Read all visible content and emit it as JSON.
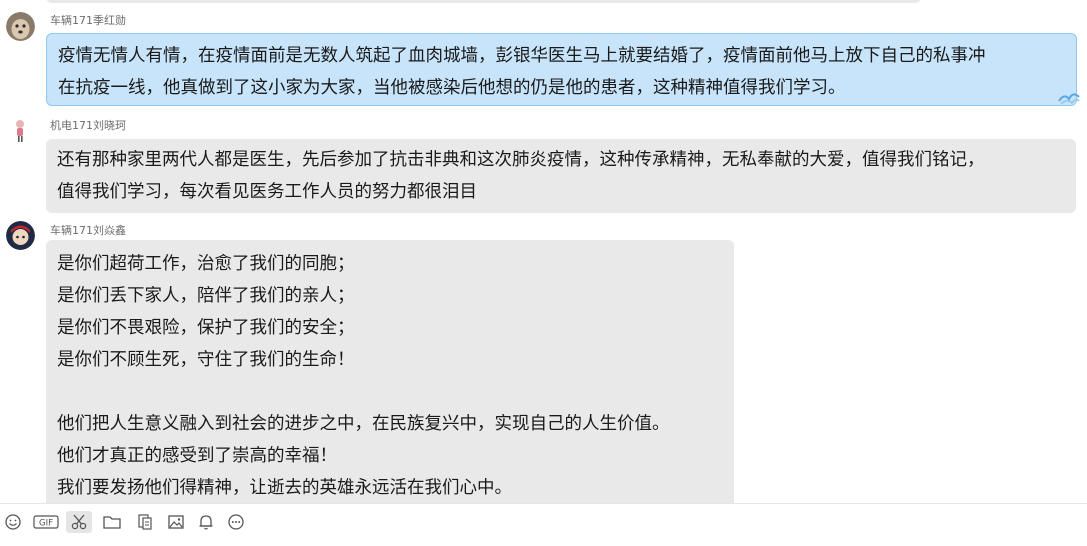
{
  "messages": [
    {
      "sender": "车辆171季红勋",
      "lines": [
        "疫情无情人有情，在疫情面前是无数人筑起了血肉城墙，彭银华医生马上就要结婚了，疫情面前他马上放下自己的私事冲",
        "在抗疫一线，他真做到了这小家为大家，当他被感染后他想的仍是他的患者，这种精神值得我们学习。"
      ]
    },
    {
      "sender": "机电171刘晓珂",
      "lines": [
        "还有那种家里两代人都是医生，先后参加了抗击非典和这次肺炎疫情，这种传承精神，无私奉献的大爱，值得我们铭记，",
        "值得我们学习，每次看见医务工作人员的努力都很泪目"
      ]
    },
    {
      "sender": "车辆171刘焱鑫",
      "lines": [
        "是你们超荷工作，治愈了我们的同胞；",
        "是你们丢下家人，陪伴了我们的亲人；",
        "是你们不畏艰险，保护了我们的安全；",
        "是你们不顾生死，守住了我们的生命！",
        "",
        "他们把人生意义融入到社会的进步之中，在民族复兴中，实现自己的人生价值。",
        "他们才真正的感受到了崇高的幸福！",
        "我们要发扬他们得精神，让逝去的英雄永远活在我们心中。"
      ]
    }
  ],
  "toolbar": {
    "items": [
      "emoji-icon",
      "gif-icon",
      "scissors-icon",
      "folder-icon",
      "file-icon",
      "image-icon",
      "bell-icon",
      "more-icon"
    ],
    "active": "scissors-icon",
    "gif_label": "GIF"
  },
  "colors": {
    "own_bubble": "#c7e4fb",
    "own_bubble_border": "#93c7ef",
    "other_bubble": "#e9e9e9",
    "sender_text": "#6d6d6d"
  }
}
